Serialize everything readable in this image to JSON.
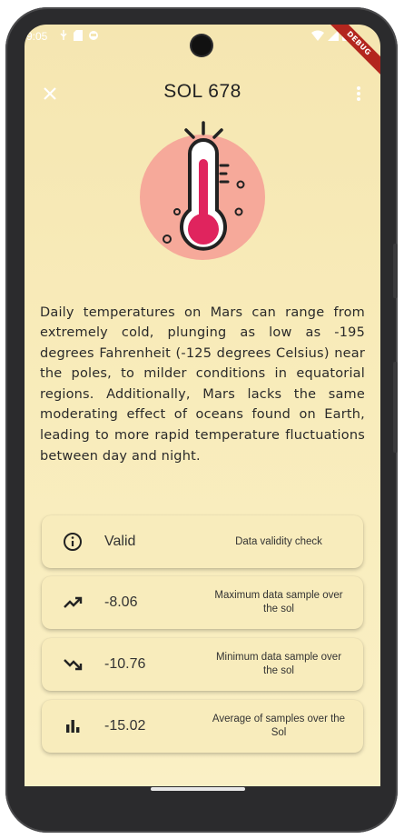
{
  "status_bar": {
    "time": "9:05",
    "left_icons": [
      "usb-icon",
      "sd-card-icon",
      "sync-icon"
    ],
    "right_icons": [
      "wifi-icon",
      "signal-icon",
      "battery-icon"
    ]
  },
  "debug_banner": "DEBUG",
  "app_bar": {
    "title": "SOL 678",
    "close_icon": "close-icon",
    "menu_icon": "more-vert-icon"
  },
  "hero_icon": "thermometer-icon",
  "description": "Daily temperatures on Mars can range from extremely cold, plunging as low as -195 degrees Fahrenheit (-125 degrees Celsius) near the poles, to milder conditions in equatorial regions. Additionally, Mars lacks the same moderating effect of oceans found on Earth, leading to more rapid temperature fluctuations between day and night.",
  "cards": [
    {
      "icon": "info-icon",
      "value": "Valid",
      "caption": "Data validity check"
    },
    {
      "icon": "trending-up-icon",
      "value": "-8.06",
      "caption": "Maximum data sample over the sol"
    },
    {
      "icon": "trending-down-icon",
      "value": "-10.76",
      "caption": "Minimum data sample over the sol"
    },
    {
      "icon": "bar-chart-icon",
      "value": "-15.02",
      "caption": "Average of samples over the Sol"
    }
  ],
  "colors": {
    "background": "#f7e9b6",
    "card": "#f8ecbc",
    "thermometer_circle": "#f6a99a",
    "thermometer_fill": "#e0245e"
  }
}
